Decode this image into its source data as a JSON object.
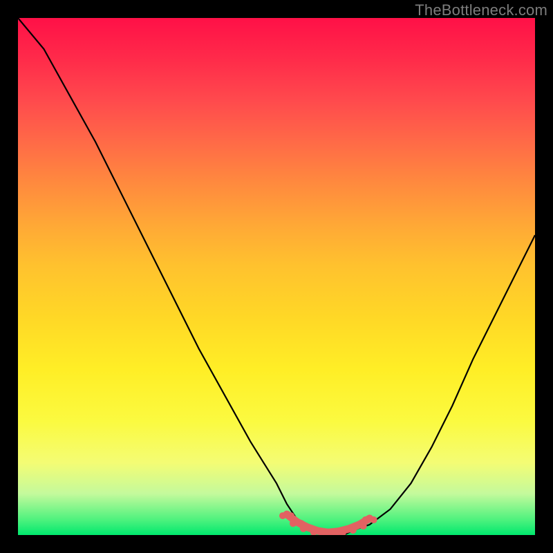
{
  "attribution": "TheBottleneck.com",
  "chart_data": {
    "type": "line",
    "title": "",
    "xlabel": "",
    "ylabel": "",
    "xlim": [
      0,
      100
    ],
    "ylim": [
      0,
      100
    ],
    "series": [
      {
        "name": "bottleneck-curve",
        "x": [
          0,
          5,
          10,
          15,
          20,
          25,
          30,
          35,
          40,
          45,
          50,
          52,
          54,
          57,
          60,
          63,
          65,
          68,
          72,
          76,
          80,
          84,
          88,
          92,
          96,
          100
        ],
        "values": [
          100,
          94,
          85,
          76,
          66,
          56,
          46,
          36,
          27,
          18,
          10,
          6,
          3,
          1,
          0,
          0,
          1,
          2,
          5,
          10,
          17,
          25,
          34,
          42,
          50,
          58
        ]
      },
      {
        "name": "low-bottleneck-band",
        "x": [
          52,
          54,
          56,
          58,
          60,
          62,
          64,
          66,
          68
        ],
        "values": [
          4.0,
          2.5,
          1.5,
          0.8,
          0.5,
          0.7,
          1.2,
          2.0,
          3.2
        ]
      }
    ],
    "colors": {
      "curve": "#000000",
      "band": "#e26262",
      "gradient_top": "#ff1047",
      "gradient_bottom": "#00e86e"
    }
  }
}
